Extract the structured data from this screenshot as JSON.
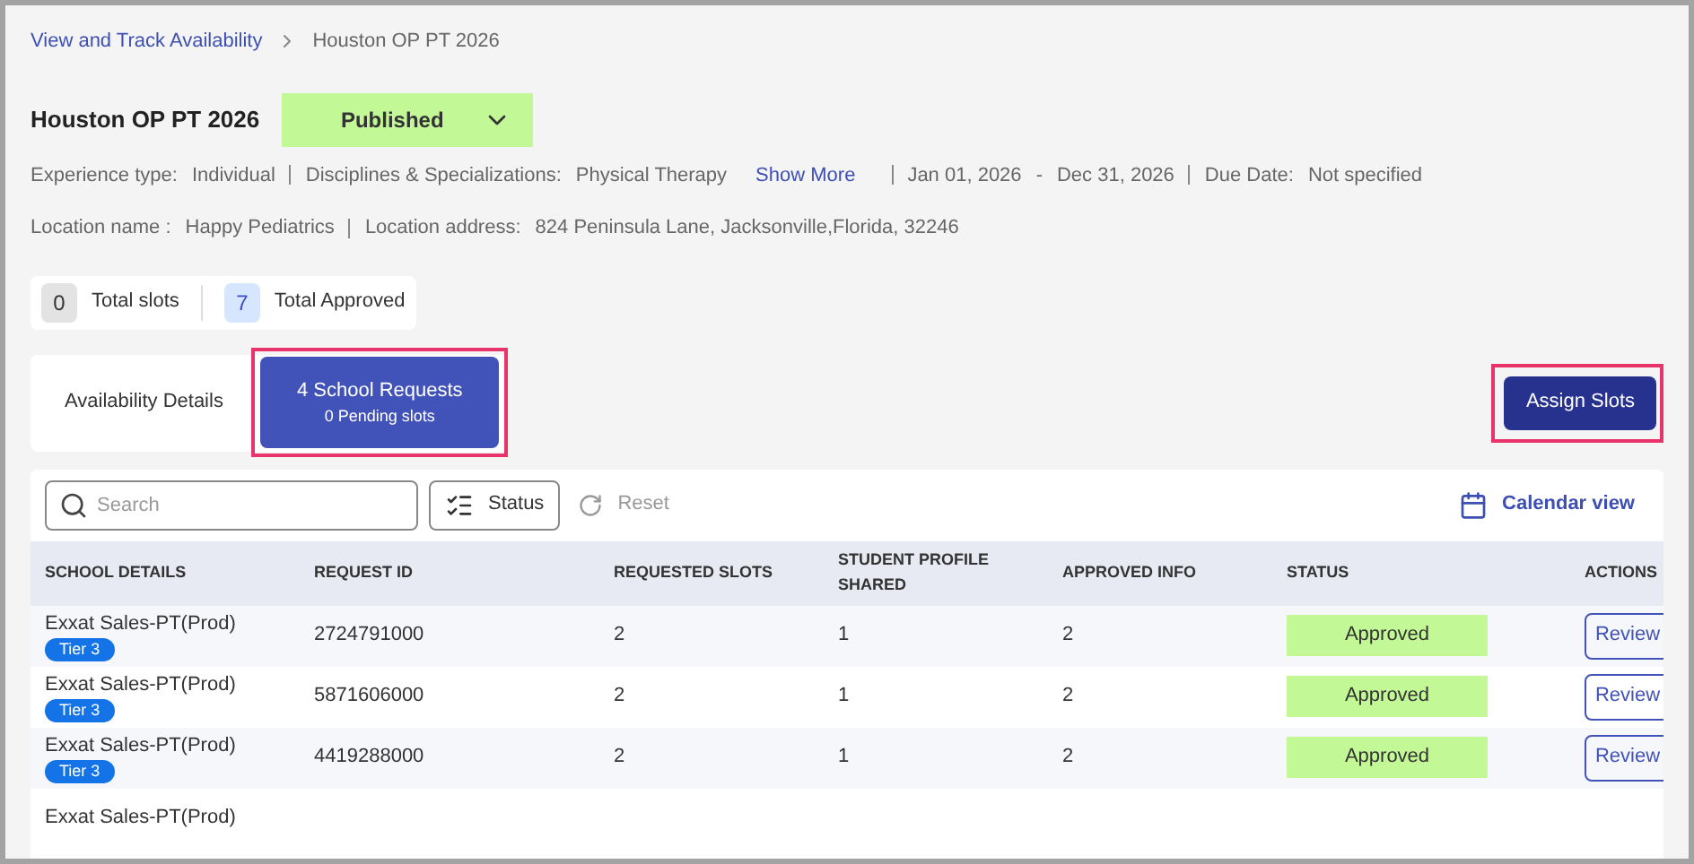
{
  "breadcrumb": [
    {
      "label": "View and Track Availability",
      "kind": "link"
    },
    {
      "label": "Houston OP PT 2026",
      "kind": "current"
    }
  ],
  "title": "Houston OP PT 2026",
  "status_dropdown": {
    "value": "Published"
  },
  "meta_line_1": [
    {
      "label": "Experience type:",
      "value": "Individual"
    },
    {
      "label": "Disciplines & Specializations:",
      "value": "Physical Therapy",
      "link": "Show More"
    }
  ],
  "date_range": {
    "start": "Jan 01, 2026",
    "separator": "-",
    "end": "Dec 31, 2026"
  },
  "due_date": {
    "label": "Due Date:",
    "value": "Not specified"
  },
  "meta_line_2": [
    {
      "label": "Location name :",
      "value": "Happy Pediatrics"
    },
    {
      "label": "Location address:",
      "value": "824 Peninsula Lane, Jacksonville,Florida, 32246"
    }
  ],
  "stats": [
    {
      "count": "0",
      "label": "Total slots",
      "kind": "neutral"
    },
    {
      "count": "7",
      "label": "Total Approved",
      "kind": "approved"
    }
  ],
  "tabs": [
    {
      "title": "Availability Details",
      "selected": false
    },
    {
      "title": "4 School Requests",
      "subtitle": "0 Pending slots",
      "selected": true,
      "highlighted": true
    }
  ],
  "assign_button": {
    "label": "Assign Slots",
    "highlighted": true
  },
  "toolbar": {
    "search_placeholder": "Search",
    "status_filter": "Status",
    "reset": "Reset",
    "calendar_view": "Calendar view"
  },
  "table": {
    "columns": [
      "SCHOOL DETAILS",
      "REQUEST ID",
      "REQUESTED SLOTS",
      "STUDENT PROFILE SHARED",
      "APPROVED INFO",
      "STATUS",
      "ACTIONS"
    ],
    "rows": [
      {
        "school": "Exxat Sales-PT(Prod)",
        "tier": "Tier 3",
        "request_id": "2724791000",
        "requested": "2",
        "shared": "1",
        "approved": "2",
        "status": "Approved",
        "action": "Review"
      },
      {
        "school": "Exxat Sales-PT(Prod)",
        "tier": "Tier 3",
        "request_id": "5871606000",
        "requested": "2",
        "shared": "1",
        "approved": "2",
        "status": "Approved",
        "action": "Review"
      },
      {
        "school": "Exxat Sales-PT(Prod)",
        "tier": "Tier 3",
        "request_id": "4419288000",
        "requested": "2",
        "shared": "1",
        "approved": "2",
        "status": "Approved",
        "action": "Review"
      },
      {
        "school": "Exxat Sales-PT(Prod)"
      }
    ]
  }
}
